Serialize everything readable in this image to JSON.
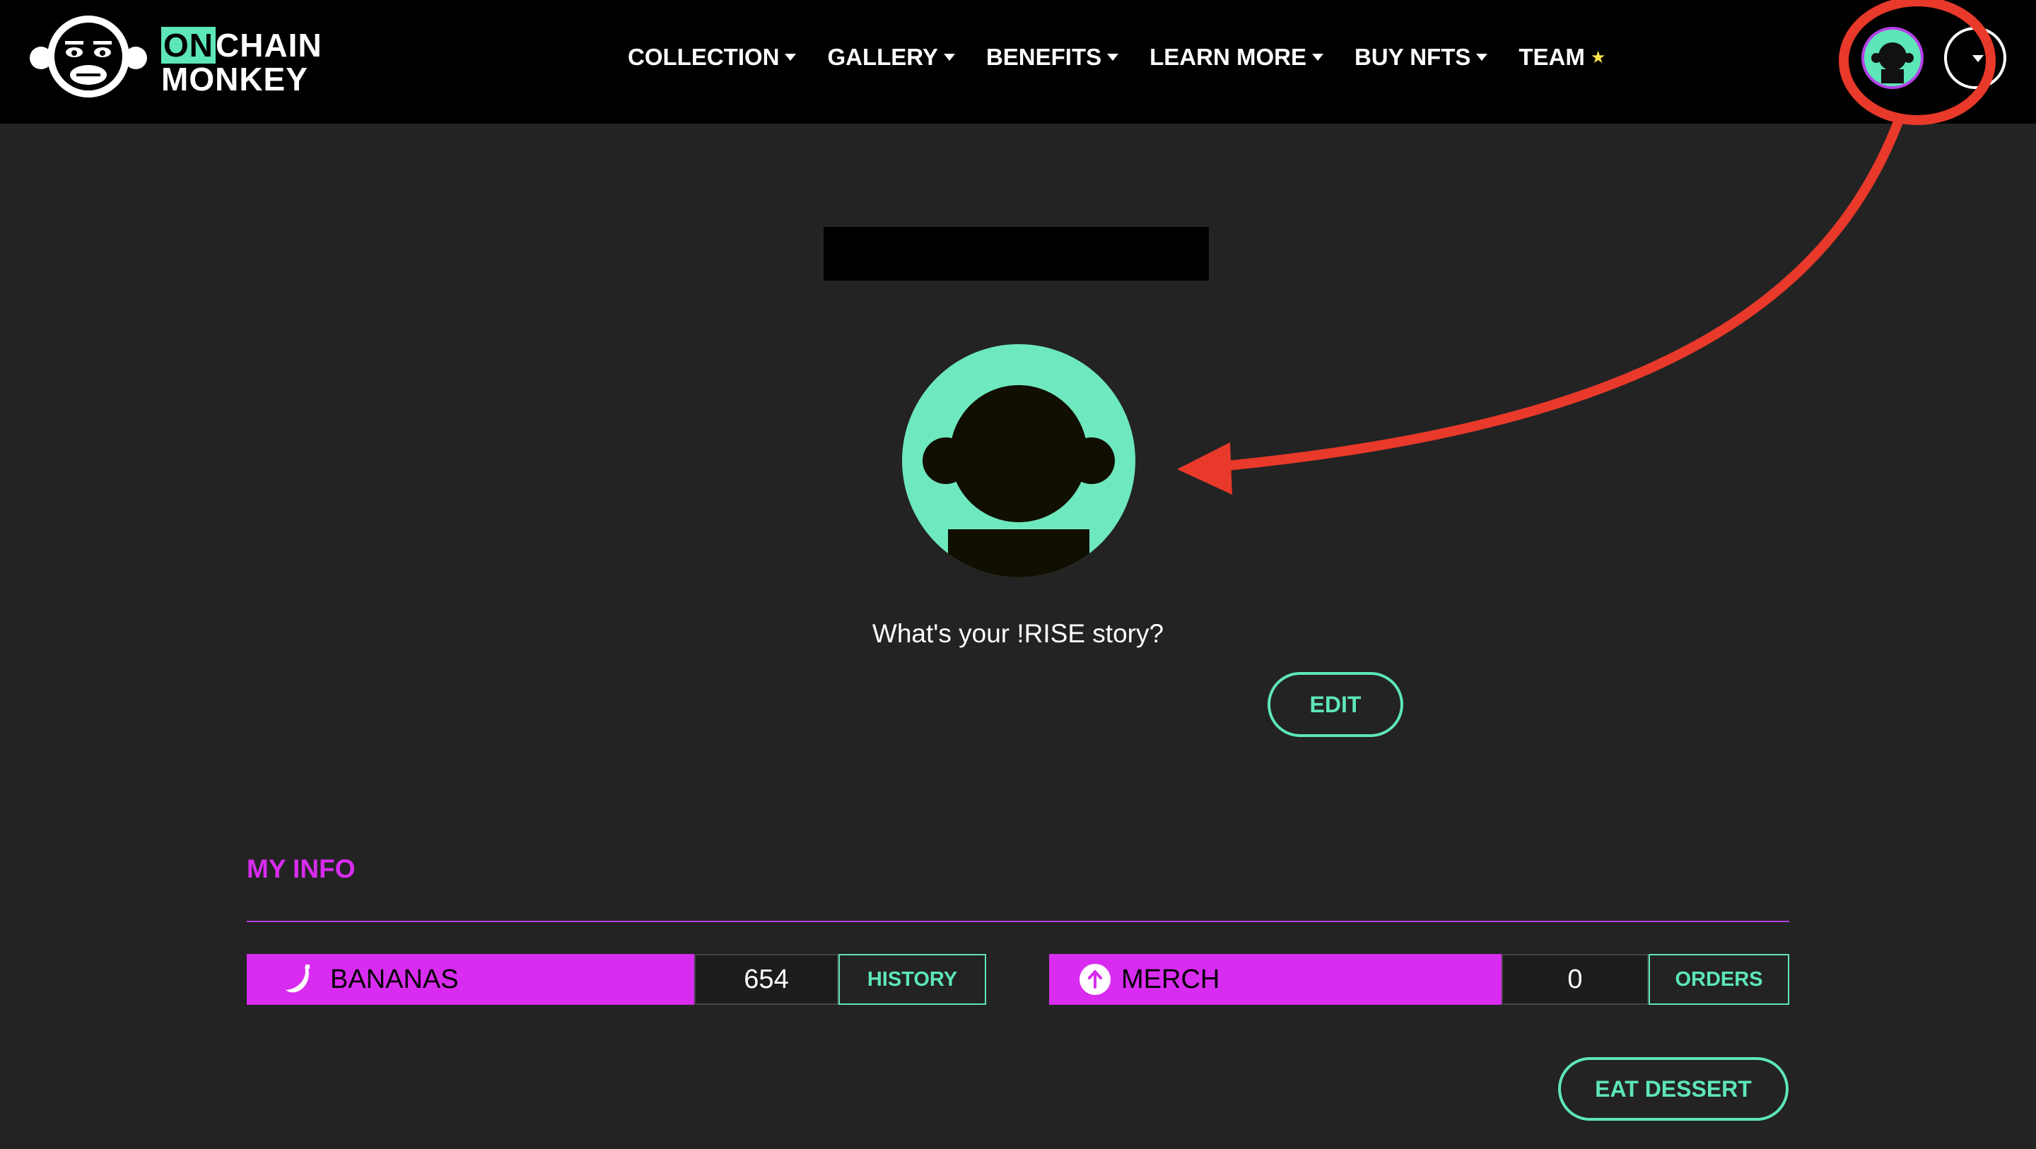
{
  "brand": {
    "on": "ON",
    "chain": "CHAIN",
    "monkey": "MONKEY"
  },
  "nav": {
    "items": [
      {
        "label": "COLLECTION",
        "has_caret": true
      },
      {
        "label": "GALLERY",
        "has_caret": true
      },
      {
        "label": "BENEFITS",
        "has_caret": true
      },
      {
        "label": "LEARN MORE",
        "has_caret": true
      },
      {
        "label": "BUY NFTS",
        "has_caret": true
      },
      {
        "label": "TEAM",
        "has_caret": false
      }
    ],
    "team_icon": "star-icon"
  },
  "profile": {
    "name_redacted": true,
    "story_prompt": "What's your !RISE story?",
    "edit_label": "EDIT"
  },
  "my_info": {
    "title": "MY INFO",
    "bananas": {
      "label": "BANANAS",
      "value": "654",
      "action": "HISTORY",
      "icon": "banana-icon"
    },
    "merch": {
      "label": "MERCH",
      "value": "0",
      "action": "ORDERS",
      "icon": "arrow-up-circle-icon"
    },
    "dessert_label": "EAT DESSERT"
  },
  "colors": {
    "background": "#232323",
    "nav_background": "#000000",
    "accent_mint": "#5de6b8",
    "accent_magenta": "#d82cf0",
    "annotation_red": "#e8392a"
  }
}
